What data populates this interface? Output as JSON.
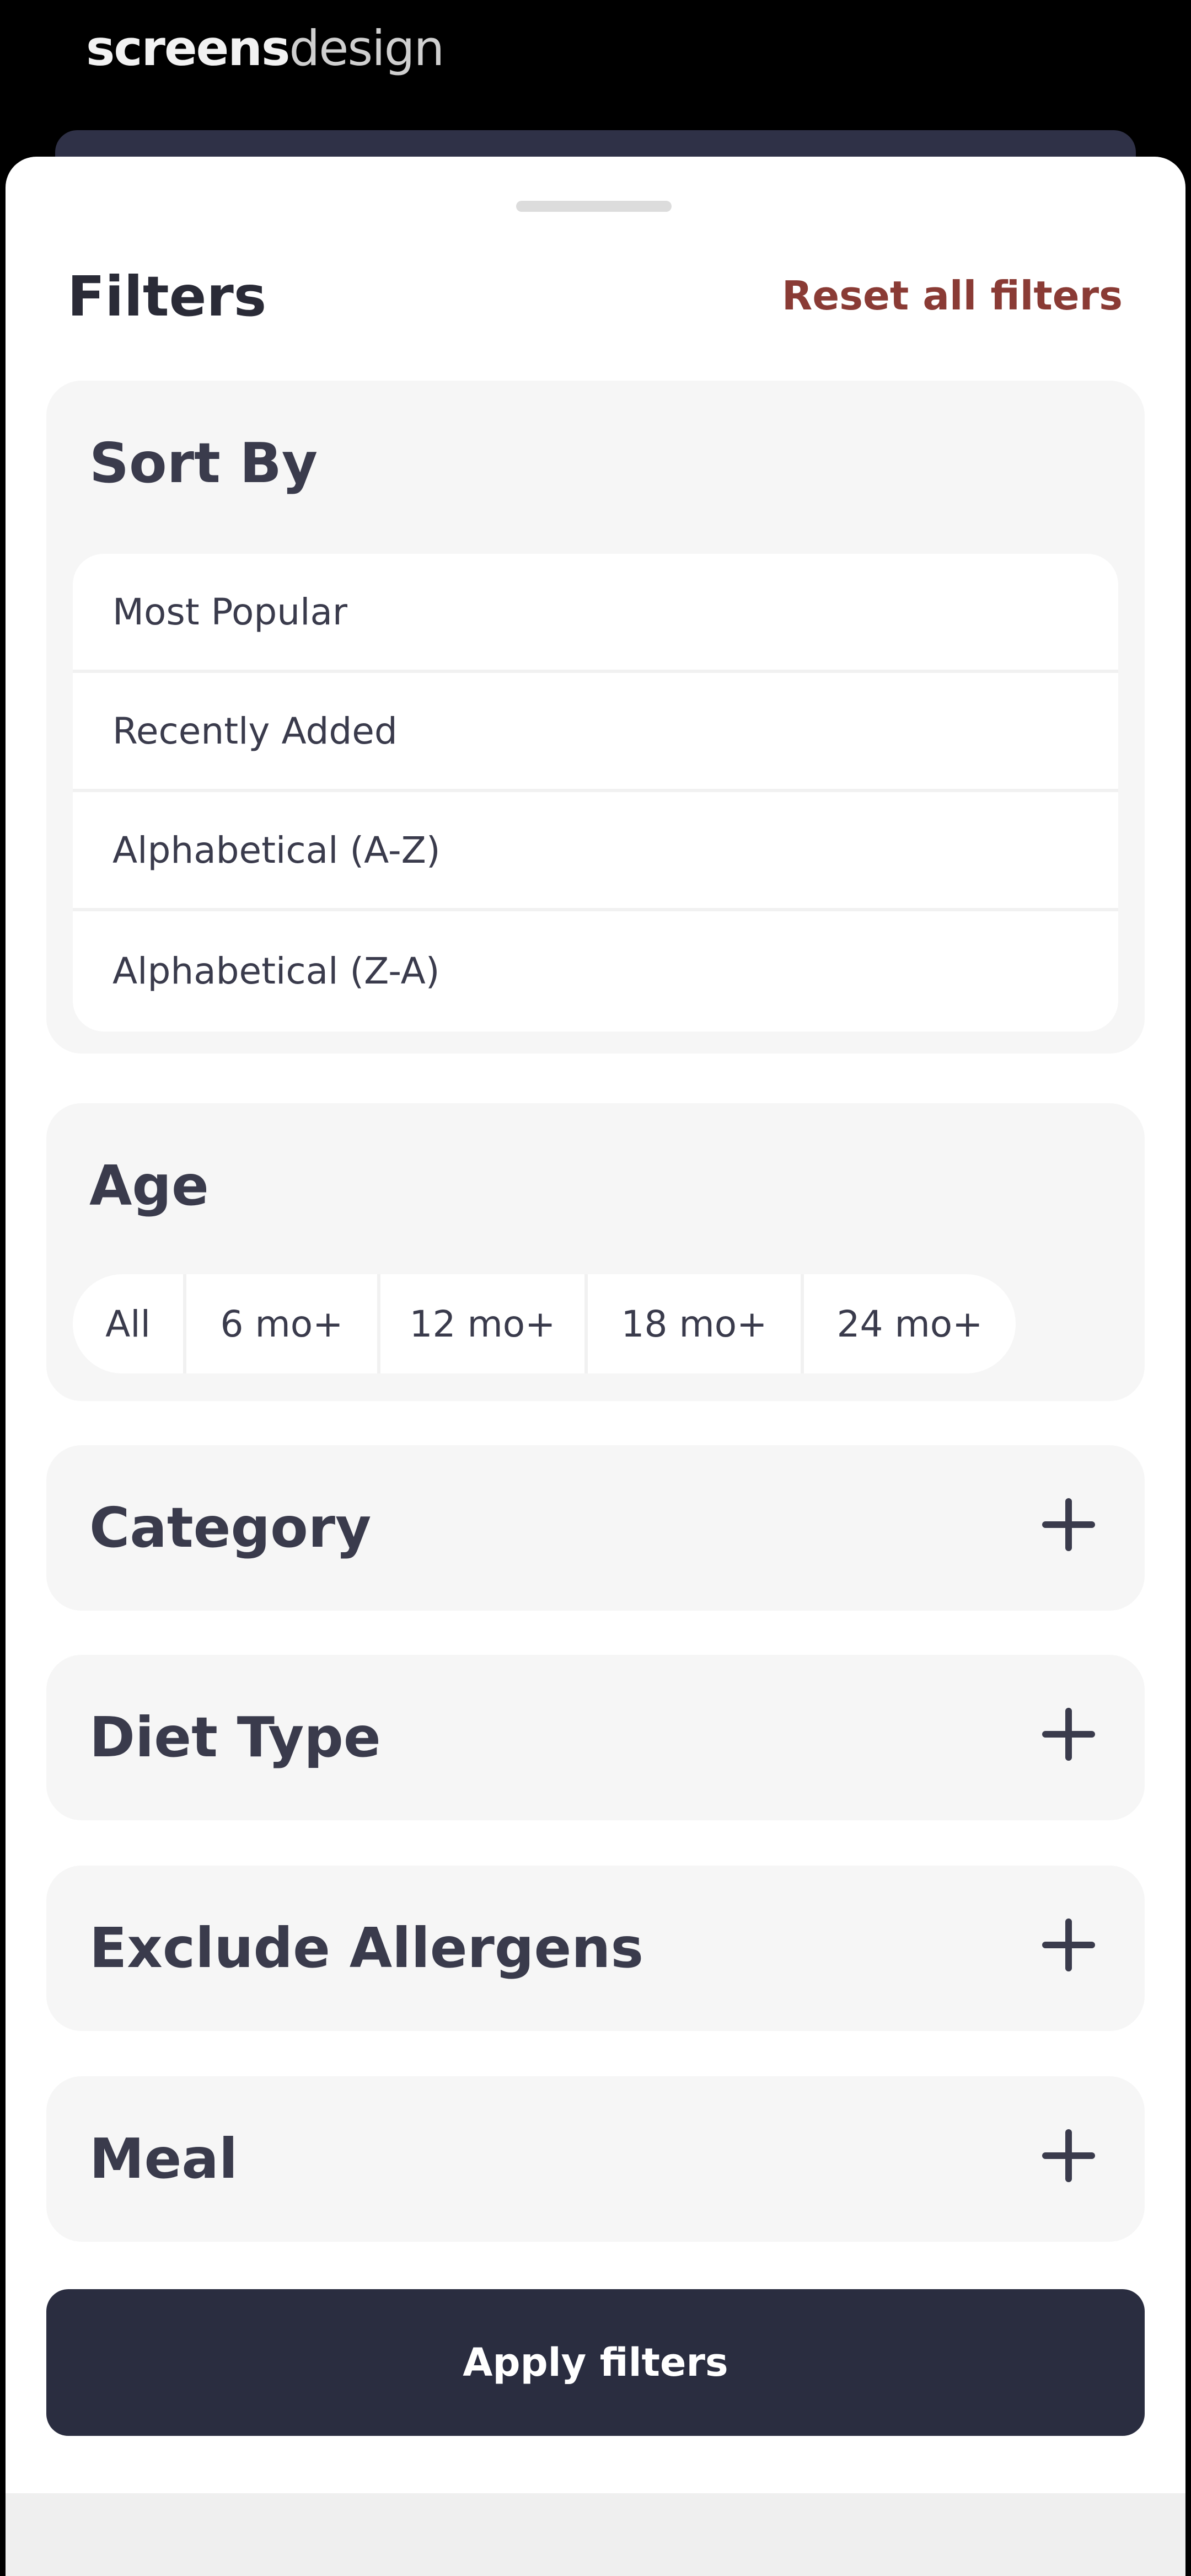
{
  "brand": {
    "part1": "screens",
    "part2": "design"
  },
  "header": {
    "title": "Filters",
    "reset_label": "Reset all filters"
  },
  "sort_by": {
    "title": "Sort By",
    "options": [
      "Most Popular",
      "Recently Added",
      "Alphabetical (A-Z)",
      "Alphabetical (Z-A)"
    ]
  },
  "age": {
    "title": "Age",
    "options": [
      "All",
      "6 mo+",
      "12 mo+",
      "18 mo+",
      "24 mo+"
    ]
  },
  "sections": [
    {
      "title": "Category",
      "icon": "plus-icon"
    },
    {
      "title": "Diet Type",
      "icon": "plus-icon"
    },
    {
      "title": "Exclude Allergens",
      "icon": "plus-icon"
    },
    {
      "title": "Meal",
      "icon": "plus-icon"
    }
  ],
  "apply_label": "Apply filters",
  "colors": {
    "accent_red": "#8a3b35",
    "primary_dark": "#2a2d40",
    "section_bg": "#f6f6f6"
  }
}
